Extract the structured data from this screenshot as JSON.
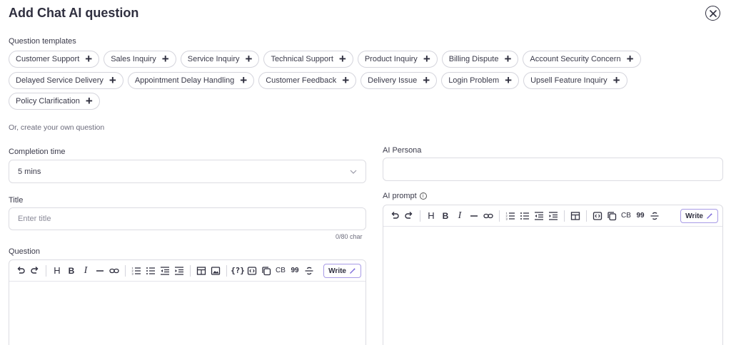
{
  "header": {
    "title": "Add Chat AI question",
    "close_icon": "close-circle-icon"
  },
  "templates": {
    "label": "Question templates",
    "rows": [
      [
        "Customer Support",
        "Sales Inquiry",
        "Service Inquiry",
        "Technical Support",
        "Product Inquiry",
        "Billing Dispute",
        "Account Security Concern"
      ],
      [
        "Delayed Service Delivery",
        "Appointment Delay Handling",
        "Customer Feedback",
        "Delivery Issue",
        "Login Problem",
        "Upsell Feature Inquiry"
      ],
      [
        "Policy Clarification"
      ]
    ],
    "add_icon": "plus-icon"
  },
  "create_own_label": "Or, create your own question",
  "completion_time": {
    "label": "Completion time",
    "value": "5 mins"
  },
  "title_field": {
    "label": "Title",
    "placeholder": "Enter title",
    "counter": "0/80 char"
  },
  "question": {
    "label": "Question",
    "write_label": "Write"
  },
  "ai_persona": {
    "label": "AI Persona",
    "value": ""
  },
  "ai_prompt": {
    "label": "AI prompt",
    "write_label": "Write"
  },
  "toolbar": {
    "heading": "H",
    "bold": "B",
    "italic": "I",
    "codeblock": "CB",
    "quote": "99",
    "variable": "{?}"
  }
}
